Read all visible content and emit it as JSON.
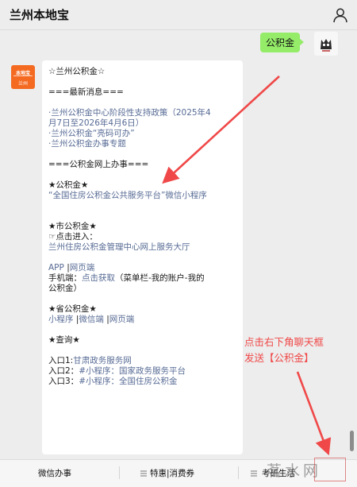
{
  "header": {
    "title": "兰州本地宝"
  },
  "outgoing": {
    "text": "公积金"
  },
  "bot": {
    "avatar_line1": "本地宝",
    "avatar_line2": "兰州"
  },
  "message": {
    "title": "☆兰州公积金☆",
    "news_heading": "===最新消息===",
    "news_1a": "·兰州公积金中心阶段性支持政策（2025年4",
    "news_1b": "月7日至2026年4月6日）",
    "news_2": "·兰州公积金“亮码可办”",
    "news_3": "·兰州公积金办事专题",
    "online_heading": "===公积金网上办事===",
    "natl_heading": "★公积金★",
    "natl_link": "“全国住房公积金公共服务平台”微信小程序",
    "city_heading": "★市公积金★",
    "city_click": "☞点击进入：",
    "city_link": "兰州住房公积金管理中心网上服务大厅",
    "app_link": "APP",
    "app_sep": " |",
    "web_link": "网页端",
    "mobile_label": "手机端：",
    "mobile_link": "点击获取",
    "mobile_note_a": "（菜单栏-我的账户-我的",
    "mobile_note_b": "公积金）",
    "prov_heading": "★省公积金★",
    "prov_mini": "小程序",
    "prov_sep1": " |",
    "prov_wechat": "微信端",
    "prov_sep2": " |",
    "prov_web": "网页端",
    "query_heading": "★查询★",
    "q1_label": "入口1:",
    "q1_link": "甘肃政务服务网",
    "q2_label": "入口2：",
    "q2_link": "#小程序：国家政务服务平台",
    "q3_label": "入口3：",
    "q3_link": "#小程序：全国住房公积金"
  },
  "annotation": {
    "line1": "点击右下角聊天框",
    "line2": "发送【公积金】"
  },
  "bottom_menu": {
    "item1": "微信办事",
    "item2": "特惠|消费券",
    "item3": "考研生活"
  },
  "watermark": {
    "text": "茗水网"
  },
  "colors": {
    "accent_link": "#576b95",
    "bubble_green": "#95ec69",
    "annotation_red": "#f04848"
  }
}
